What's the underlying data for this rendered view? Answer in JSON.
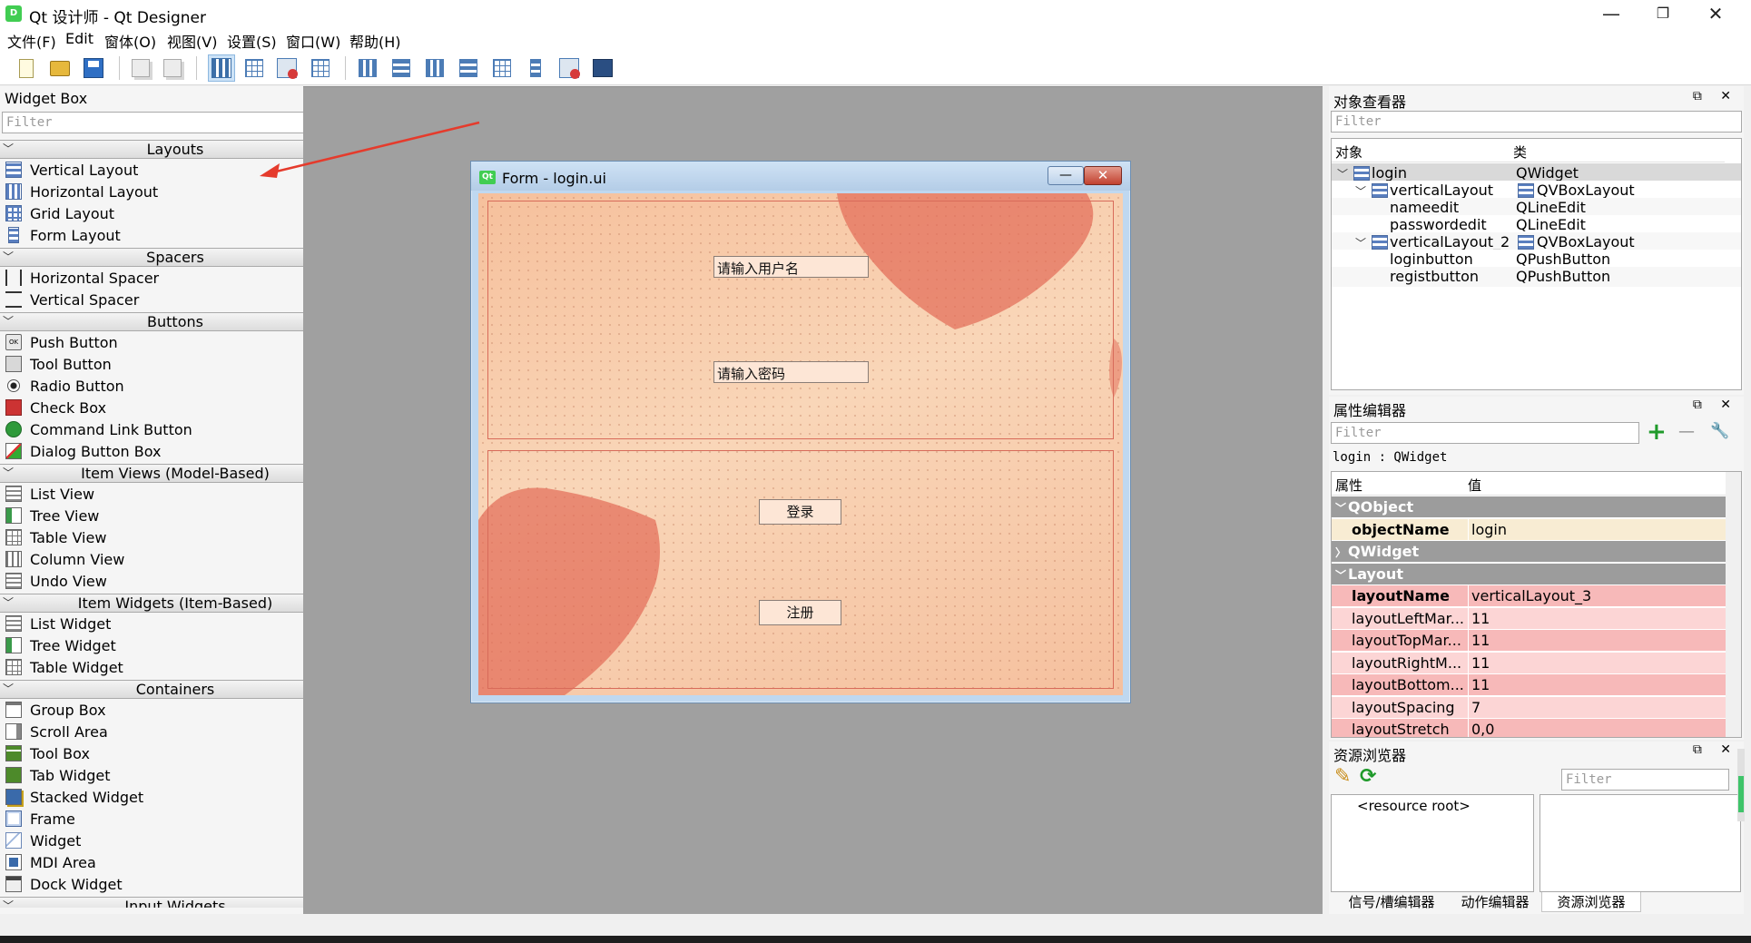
{
  "window": {
    "app_icon": "D",
    "title": "Qt 设计师 - Qt Designer",
    "controls": {
      "minimize": "—",
      "maximize": "❐",
      "close": "✕"
    }
  },
  "menubar": [
    "文件(F)",
    "Edit",
    "窗体(O)",
    "视图(V)",
    "设置(S)",
    "窗口(W)",
    "帮助(H)"
  ],
  "toolbar": {
    "icons": [
      "new-form-icon",
      "open-form-icon",
      "save-form-icon",
      "copy-icon",
      "paste-icon",
      "edit-widgets-icon",
      "edit-signals-slots-icon",
      "edit-buddies-icon",
      "edit-tab-order-icon",
      "lay-out-horizontally-icon",
      "lay-out-vertically-icon",
      "lay-out-horizontal-splitter-icon",
      "lay-out-vertical-splitter-icon",
      "lay-out-grid-icon",
      "lay-out-form-icon",
      "break-layout-icon",
      "adjust-size-icon"
    ]
  },
  "widgetbox": {
    "title": "Widget Box",
    "dock_buttons": "⧉ ✕",
    "filter_placeholder": "Filter",
    "categories": [
      {
        "name": "Layouts",
        "items": [
          {
            "label": "Vertical Layout",
            "icon": "vl"
          },
          {
            "label": "Horizontal Layout",
            "icon": "hl"
          },
          {
            "label": "Grid Layout",
            "icon": "gl"
          },
          {
            "label": "Form Layout",
            "icon": "fl"
          }
        ]
      },
      {
        "name": "Spacers",
        "items": [
          {
            "label": "Horizontal Spacer",
            "icon": "hs"
          },
          {
            "label": "Vertical Spacer",
            "icon": "vs"
          }
        ]
      },
      {
        "name": "Buttons",
        "items": [
          {
            "label": "Push Button",
            "icon": "push"
          },
          {
            "label": "Tool Button",
            "icon": "tool"
          },
          {
            "label": "Radio Button",
            "icon": "radio"
          },
          {
            "label": "Check Box",
            "icon": "check"
          },
          {
            "label": "Command Link Button",
            "icon": "cmdlink"
          },
          {
            "label": "Dialog Button Box",
            "icon": "dlg"
          }
        ]
      },
      {
        "name": "Item Views (Model-Based)",
        "items": [
          {
            "label": "List View",
            "icon": "list"
          },
          {
            "label": "Tree View",
            "icon": "tree"
          },
          {
            "label": "Table View",
            "icon": "table"
          },
          {
            "label": "Column View",
            "icon": "column"
          },
          {
            "label": "Undo View",
            "icon": "undo"
          }
        ]
      },
      {
        "name": "Item Widgets (Item-Based)",
        "items": [
          {
            "label": "List Widget",
            "icon": "list"
          },
          {
            "label": "Tree Widget",
            "icon": "tree"
          },
          {
            "label": "Table Widget",
            "icon": "table"
          }
        ]
      },
      {
        "name": "Containers",
        "items": [
          {
            "label": "Group Box",
            "icon": "group"
          },
          {
            "label": "Scroll Area",
            "icon": "scroll"
          },
          {
            "label": "Tool Box",
            "icon": "toolbox"
          },
          {
            "label": "Tab Widget",
            "icon": "tabw"
          },
          {
            "label": "Stacked Widget",
            "icon": "stacked"
          },
          {
            "label": "Frame",
            "icon": "frame"
          },
          {
            "label": "Widget",
            "icon": "widget"
          },
          {
            "label": "MDI Area",
            "icon": "mdi"
          },
          {
            "label": "Dock Widget",
            "icon": "dock"
          }
        ]
      },
      {
        "name": "Input Widgets",
        "items": []
      }
    ]
  },
  "form": {
    "icon_text": "Qt",
    "title": "Form - login.ui",
    "min_glyph": "—",
    "close_glyph": "✕",
    "username_text": "请输入用户名",
    "password_text": "请输入密码",
    "login_text": "登录",
    "register_text": "注册"
  },
  "object_inspector": {
    "title": "对象查看器",
    "dock_buttons": "⧉ ✕",
    "filter_placeholder": "Filter",
    "col_object": "对象",
    "col_class": "类",
    "rows": [
      {
        "object": "login",
        "class": "QWidget"
      },
      {
        "object": "verticalLayout",
        "class": "QVBoxLayout"
      },
      {
        "object": "nameedit",
        "class": "QLineEdit"
      },
      {
        "object": "passwordedit",
        "class": "QLineEdit"
      },
      {
        "object": "verticalLayout_2",
        "class": "QVBoxLayout"
      },
      {
        "object": "loginbutton",
        "class": "QPushButton"
      },
      {
        "object": "registbutton",
        "class": "QPushButton"
      }
    ]
  },
  "property_editor": {
    "title": "属性编辑器",
    "dock_buttons": "⧉ ✕",
    "filter_placeholder": "Filter",
    "add_glyph": "+",
    "remove_glyph": "—",
    "configure_glyph": "🔧",
    "context": "login : QWidget",
    "col_property": "属性",
    "col_value": "值",
    "rows": [
      {
        "name": "QObject",
        "value": "",
        "kind": "group",
        "expanded": true
      },
      {
        "name": "objectName",
        "value": "login",
        "kind": "bold-hl"
      },
      {
        "name": "QWidget",
        "value": "",
        "kind": "group",
        "expanded": false
      },
      {
        "name": "Layout",
        "value": "",
        "kind": "group",
        "expanded": true
      },
      {
        "name": "layoutName",
        "value": "verticalLayout_3",
        "kind": "bold-pk"
      },
      {
        "name": "layoutLeftMar...",
        "value": "11",
        "kind": "pk2"
      },
      {
        "name": "layoutTopMar...",
        "value": "11",
        "kind": "pk1"
      },
      {
        "name": "layoutRightM...",
        "value": "11",
        "kind": "pk2"
      },
      {
        "name": "layoutBottom...",
        "value": "11",
        "kind": "pk1"
      },
      {
        "name": "layoutSpacing",
        "value": "7",
        "kind": "pk2"
      },
      {
        "name": "layoutStretch",
        "value": "0,0",
        "kind": "pk1"
      }
    ]
  },
  "resource_browser": {
    "title": "资源浏览器",
    "dock_buttons": "⧉ ✕",
    "filter_placeholder": "Filter",
    "root": "<resource root>",
    "edit_glyph": "✎",
    "reload_glyph": "⟳"
  },
  "bottom_tabs": [
    "信号/槽编辑器",
    "动作编辑器",
    "资源浏览器"
  ],
  "colors": {
    "accent_arrow": "#e53b2c",
    "heart": "#e26a55"
  }
}
